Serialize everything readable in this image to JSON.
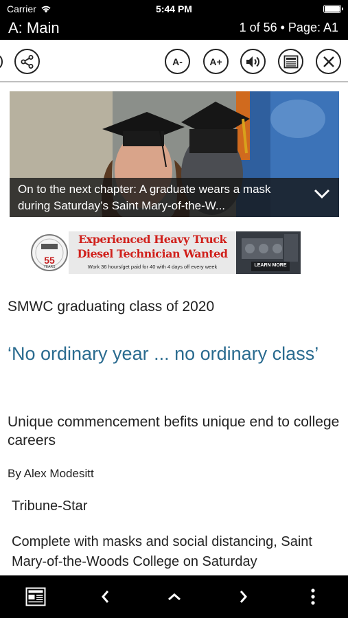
{
  "status": {
    "carrier": "Carrier",
    "time": "5:44 PM"
  },
  "titlebar": {
    "section": "A: Main",
    "page_info": "1 of 56 • Page: A1"
  },
  "toolbar": {
    "share_icon": "share-icon",
    "font_decrease_label": "A-",
    "font_increase_label": "A+",
    "audio_icon": "speaker-icon",
    "page_view_icon": "newspaper-icon",
    "close_icon": "close-icon"
  },
  "photo": {
    "caption": "On to the next chapter: A graduate wears a mask during Saturday’s Saint Mary-of-the-W..."
  },
  "ad": {
    "logo_number": "55",
    "logo_sub": "YEARS",
    "headline_line1": "Experienced Heavy Truck",
    "headline_line2": "Diesel Technician Wanted",
    "tagline": "Work 36 hours/get paid for 40 with 4 days off every week",
    "cta": "LEARN MORE"
  },
  "article": {
    "kicker": "SMWC graduating class of 2020",
    "headline": "‘No ordinary year ... no ordinary class’",
    "subhead": "Unique commencement befits unique end to college careers",
    "byline": "By Alex Modesitt",
    "source": "Tribune-Star",
    "body": "Complete with masks and social distancing, Saint Mary-of-the-Woods College on Saturday"
  },
  "bottombar": {
    "sections_icon": "sections-grid-icon",
    "prev_icon": "chevron-left-icon",
    "up_icon": "chevron-up-icon",
    "next_icon": "chevron-right-icon",
    "more_icon": "more-vertical-icon"
  },
  "colors": {
    "headline": "#2a6b8f",
    "bars": "#000000",
    "ad_red": "#d0201b"
  }
}
